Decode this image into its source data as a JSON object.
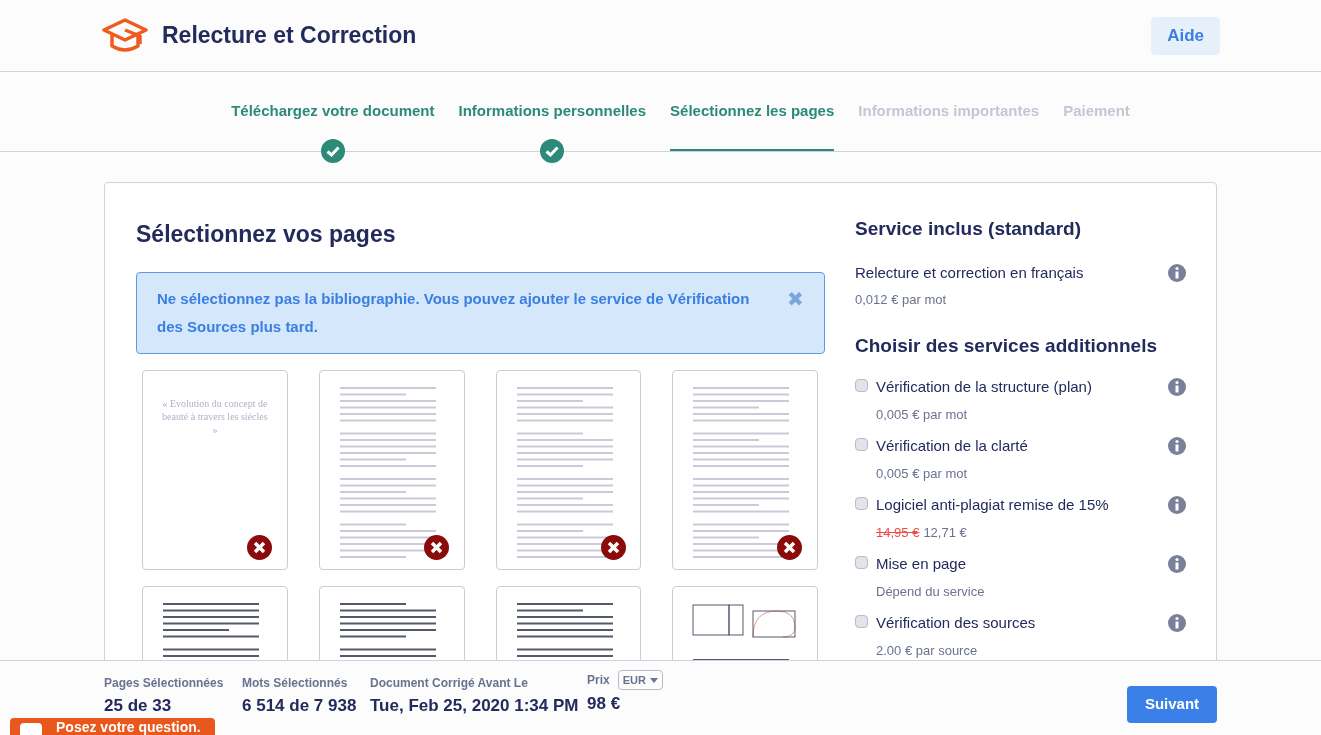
{
  "header": {
    "title": "Relecture et Correction",
    "help_button": "Aide"
  },
  "steps": [
    {
      "label": "Téléchargez votre document",
      "done": true,
      "selected": false
    },
    {
      "label": "Informations personnelles",
      "done": true,
      "selected": false
    },
    {
      "label": "Sélectionnez les pages",
      "done": false,
      "selected": true
    },
    {
      "label": "Informations importantes",
      "done": false,
      "selected": false
    },
    {
      "label": "Paiement",
      "done": false,
      "selected": false
    }
  ],
  "pages": {
    "title": "Sélectionnez vos pages",
    "notice": "Ne sélectionnez pas la bibliographie. Vous pouvez ajouter le service de Vérification des Sources plus tard.",
    "close": "✖",
    "thumbnails": [
      {
        "kind": "title",
        "selected": false,
        "title": "« Evolution du concept de beauté à travers les siècles »"
      },
      {
        "kind": "text",
        "selected": false
      },
      {
        "kind": "text",
        "selected": false
      },
      {
        "kind": "text",
        "selected": false
      },
      {
        "kind": "text",
        "selected": true
      },
      {
        "kind": "text",
        "selected": true
      },
      {
        "kind": "text",
        "selected": true
      },
      {
        "kind": "figure",
        "selected": true
      }
    ]
  },
  "services": {
    "included_title": "Service inclus (standard)",
    "included": {
      "name": "Relecture et correction en français",
      "price": "0,012 € par mot"
    },
    "additional_title": "Choisir des services additionnels",
    "additional": [
      {
        "name": "Vérification de la structure (plan)",
        "checked": false,
        "price": "0,005 € par mot"
      },
      {
        "name": "Vérification de la clarté",
        "checked": false,
        "price": "0,005 € par mot"
      },
      {
        "name": "Logiciel anti-plagiat remise de 15%",
        "checked": false,
        "old_price": "14,95 €",
        "price": "12,71 €"
      },
      {
        "name": "Mise en page",
        "checked": false,
        "price": "Dépend du service"
      },
      {
        "name": "Vérification des sources",
        "checked": false,
        "price": "2.00 € par source"
      }
    ]
  },
  "footer": {
    "stats": [
      {
        "label": "Pages Sélectionnées",
        "value": "25 de 33"
      },
      {
        "label": "Mots Sélectionnés",
        "value": "6 514 de 7 938"
      },
      {
        "label": "Document Corrigé Avant Le",
        "value": "Tue, Feb 25, 2020 1:34 PM"
      }
    ],
    "price_label": "Prix",
    "currency": "EUR",
    "price": "98 €",
    "next_button": "Suivant"
  },
  "chat": {
    "label": "Posez votre question."
  }
}
